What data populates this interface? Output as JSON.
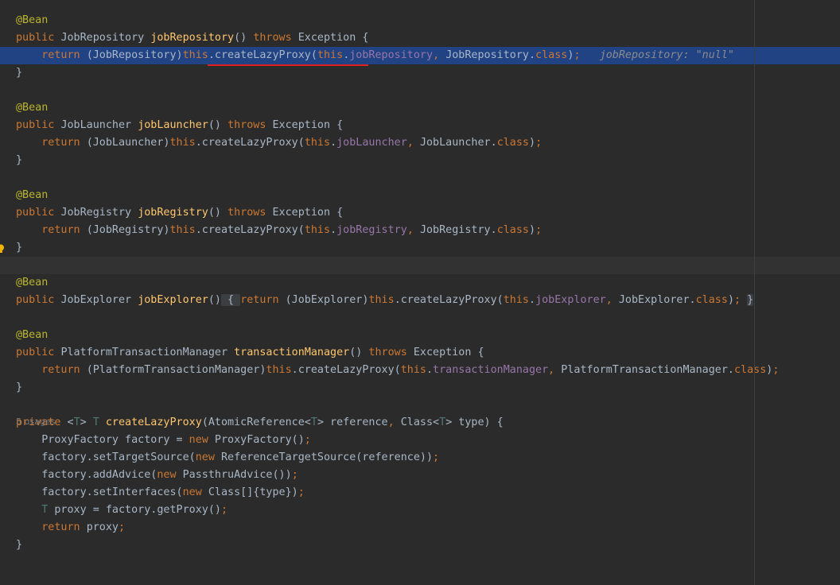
{
  "editor": {
    "annotation": "@Bean",
    "lines": [
      {
        "row": 1,
        "tokens": [
          [
            "ann",
            "@Bean"
          ]
        ]
      },
      {
        "row": 2,
        "tokens": [
          [
            "kw",
            "public "
          ],
          [
            "typ",
            "JobRepository "
          ],
          [
            "mdecl",
            "jobRepository"
          ],
          [
            "pln",
            "() "
          ],
          [
            "kw",
            "throws "
          ],
          [
            "typ",
            "Exception {"
          ]
        ]
      },
      {
        "row": 3,
        "highlight": "current",
        "tokens": [
          [
            "pln",
            "    "
          ],
          [
            "kw",
            "return "
          ],
          [
            "pln",
            "(JobRepository)"
          ],
          [
            "kw",
            "this"
          ],
          [
            "pln",
            ".createLazyProxy("
          ],
          [
            "kw",
            "this"
          ],
          [
            "pln",
            "."
          ],
          [
            "fld",
            "jobRepository"
          ],
          [
            "kw",
            ", "
          ],
          [
            "pln",
            "JobRepository."
          ],
          [
            "kw",
            "class"
          ],
          [
            "pln",
            ")"
          ],
          [
            "kw",
            ";"
          ],
          [
            "pln",
            "   "
          ],
          [
            "hint",
            "jobRepository: \"null\""
          ]
        ]
      },
      {
        "row": 4,
        "tokens": [
          [
            "pln",
            "}"
          ]
        ]
      },
      {
        "row": 6,
        "tokens": [
          [
            "ann",
            "@Bean"
          ]
        ]
      },
      {
        "row": 7,
        "tokens": [
          [
            "kw",
            "public "
          ],
          [
            "typ",
            "JobLauncher "
          ],
          [
            "mdecl",
            "jobLauncher"
          ],
          [
            "pln",
            "() "
          ],
          [
            "kw",
            "throws "
          ],
          [
            "typ",
            "Exception {"
          ]
        ]
      },
      {
        "row": 8,
        "tokens": [
          [
            "pln",
            "    "
          ],
          [
            "kw",
            "return "
          ],
          [
            "pln",
            "(JobLauncher)"
          ],
          [
            "kw",
            "this"
          ],
          [
            "pln",
            ".createLazyProxy("
          ],
          [
            "kw",
            "this"
          ],
          [
            "pln",
            "."
          ],
          [
            "fld",
            "jobLauncher"
          ],
          [
            "kw",
            ", "
          ],
          [
            "pln",
            "JobLauncher."
          ],
          [
            "kw",
            "class"
          ],
          [
            "pln",
            ")"
          ],
          [
            "kw",
            ";"
          ]
        ]
      },
      {
        "row": 9,
        "tokens": [
          [
            "pln",
            "}"
          ]
        ]
      },
      {
        "row": 11,
        "tokens": [
          [
            "ann",
            "@Bean"
          ]
        ]
      },
      {
        "row": 12,
        "tokens": [
          [
            "kw",
            "public "
          ],
          [
            "typ",
            "JobRegistry "
          ],
          [
            "mdecl",
            "jobRegistry"
          ],
          [
            "pln",
            "() "
          ],
          [
            "kw",
            "throws "
          ],
          [
            "typ",
            "Exception {"
          ]
        ]
      },
      {
        "row": 13,
        "tokens": [
          [
            "pln",
            "    "
          ],
          [
            "kw",
            "return "
          ],
          [
            "pln",
            "(JobRegistry)"
          ],
          [
            "kw",
            "this"
          ],
          [
            "pln",
            ".createLazyProxy("
          ],
          [
            "kw",
            "this"
          ],
          [
            "pln",
            "."
          ],
          [
            "fld",
            "jobRegistry"
          ],
          [
            "kw",
            ", "
          ],
          [
            "pln",
            "JobRegistry."
          ],
          [
            "kw",
            "class"
          ],
          [
            "pln",
            ")"
          ],
          [
            "kw",
            ";"
          ]
        ]
      },
      {
        "row": 14,
        "tokens": [
          [
            "pln",
            "}"
          ]
        ]
      },
      {
        "row": 15,
        "highlight": "caret-row",
        "tokens": []
      },
      {
        "row": 16,
        "tokens": [
          [
            "ann",
            "@Bean"
          ]
        ]
      },
      {
        "row": 17,
        "tokens": [
          [
            "kw",
            "public "
          ],
          [
            "typ",
            "JobExplorer "
          ],
          [
            "mdecl",
            "jobExplorer"
          ],
          [
            "pln",
            "()"
          ],
          [
            "fold",
            " { "
          ],
          [
            "kw",
            "return "
          ],
          [
            "pln",
            "(JobExplorer)"
          ],
          [
            "kw",
            "this"
          ],
          [
            "pln",
            ".createLazyProxy("
          ],
          [
            "kw",
            "this"
          ],
          [
            "pln",
            "."
          ],
          [
            "fld",
            "jobExplorer"
          ],
          [
            "kw",
            ", "
          ],
          [
            "pln",
            "JobExplorer."
          ],
          [
            "kw",
            "class"
          ],
          [
            "pln",
            ")"
          ],
          [
            "kw",
            "; "
          ],
          [
            "fold",
            "}"
          ]
        ]
      },
      {
        "row": 19,
        "tokens": [
          [
            "ann",
            "@Bean"
          ]
        ]
      },
      {
        "row": 20,
        "tokens": [
          [
            "kw",
            "public "
          ],
          [
            "typ",
            "PlatformTransactionManager "
          ],
          [
            "mdecl",
            "transactionManager"
          ],
          [
            "pln",
            "() "
          ],
          [
            "kw",
            "throws "
          ],
          [
            "typ",
            "Exception {"
          ]
        ]
      },
      {
        "row": 21,
        "tokens": [
          [
            "pln",
            "    "
          ],
          [
            "kw",
            "return "
          ],
          [
            "pln",
            "(PlatformTransactionManager)"
          ],
          [
            "kw",
            "this"
          ],
          [
            "pln",
            ".createLazyProxy("
          ],
          [
            "kw",
            "this"
          ],
          [
            "pln",
            "."
          ],
          [
            "fld",
            "transactionManager"
          ],
          [
            "kw",
            ", "
          ],
          [
            "pln",
            "PlatformTransactionManager."
          ],
          [
            "kw",
            "class"
          ],
          [
            "pln",
            ")"
          ],
          [
            "kw",
            ";"
          ]
        ]
      },
      {
        "row": 22,
        "tokens": [
          [
            "pln",
            "}"
          ]
        ]
      },
      {
        "row": 24,
        "tokens": [
          [
            "kw",
            "private "
          ],
          [
            "pln",
            "<"
          ],
          [
            "tp",
            "T"
          ],
          [
            "pln",
            "> "
          ],
          [
            "tp",
            "T "
          ],
          [
            "mdecl",
            "createLazyProxy"
          ],
          [
            "pln",
            "(AtomicReference<"
          ],
          [
            "tp",
            "T"
          ],
          [
            "pln",
            "> reference"
          ],
          [
            "kw",
            ", "
          ],
          [
            "pln",
            "Class<"
          ],
          [
            "tp",
            "T"
          ],
          [
            "pln",
            "> type) {"
          ]
        ]
      },
      {
        "row": 25,
        "tokens": [
          [
            "pln",
            "    ProxyFactory factory = "
          ],
          [
            "kw",
            "new "
          ],
          [
            "pln",
            "ProxyFactory()"
          ],
          [
            "kw",
            ";"
          ]
        ]
      },
      {
        "row": 26,
        "tokens": [
          [
            "pln",
            "    factory.setTargetSource("
          ],
          [
            "kw",
            "new "
          ],
          [
            "pln",
            "ReferenceTargetSource(reference))"
          ],
          [
            "kw",
            ";"
          ]
        ]
      },
      {
        "row": 27,
        "tokens": [
          [
            "pln",
            "    factory.addAdvice("
          ],
          [
            "kw",
            "new "
          ],
          [
            "pln",
            "PassthruAdvice())"
          ],
          [
            "kw",
            ";"
          ]
        ]
      },
      {
        "row": 28,
        "tokens": [
          [
            "pln",
            "    factory.setInterfaces("
          ],
          [
            "kw",
            "new "
          ],
          [
            "pln",
            "Class[]{type})"
          ],
          [
            "kw",
            ";"
          ]
        ]
      },
      {
        "row": 29,
        "tokens": [
          [
            "pln",
            "    "
          ],
          [
            "tp",
            "T "
          ],
          [
            "pln",
            "proxy = factory.getProxy()"
          ],
          [
            "kw",
            ";"
          ]
        ]
      },
      {
        "row": 30,
        "tokens": [
          [
            "pln",
            "    "
          ],
          [
            "kw",
            "return "
          ],
          [
            "pln",
            "proxy"
          ],
          [
            "kw",
            ";"
          ]
        ]
      },
      {
        "row": 31,
        "tokens": [
          [
            "pln",
            "}"
          ]
        ]
      }
    ],
    "usages_label": "5 usages",
    "colors": {
      "background": "#2b2b2b",
      "current_line": "#214283",
      "keyword": "#cc7832",
      "annotation": "#bbb529",
      "method_decl": "#ffc66d",
      "field": "#9876aa",
      "text": "#a9b7c6",
      "error_underline": "#e0201e"
    },
    "gutter_icon": "lightbulb-icon"
  }
}
